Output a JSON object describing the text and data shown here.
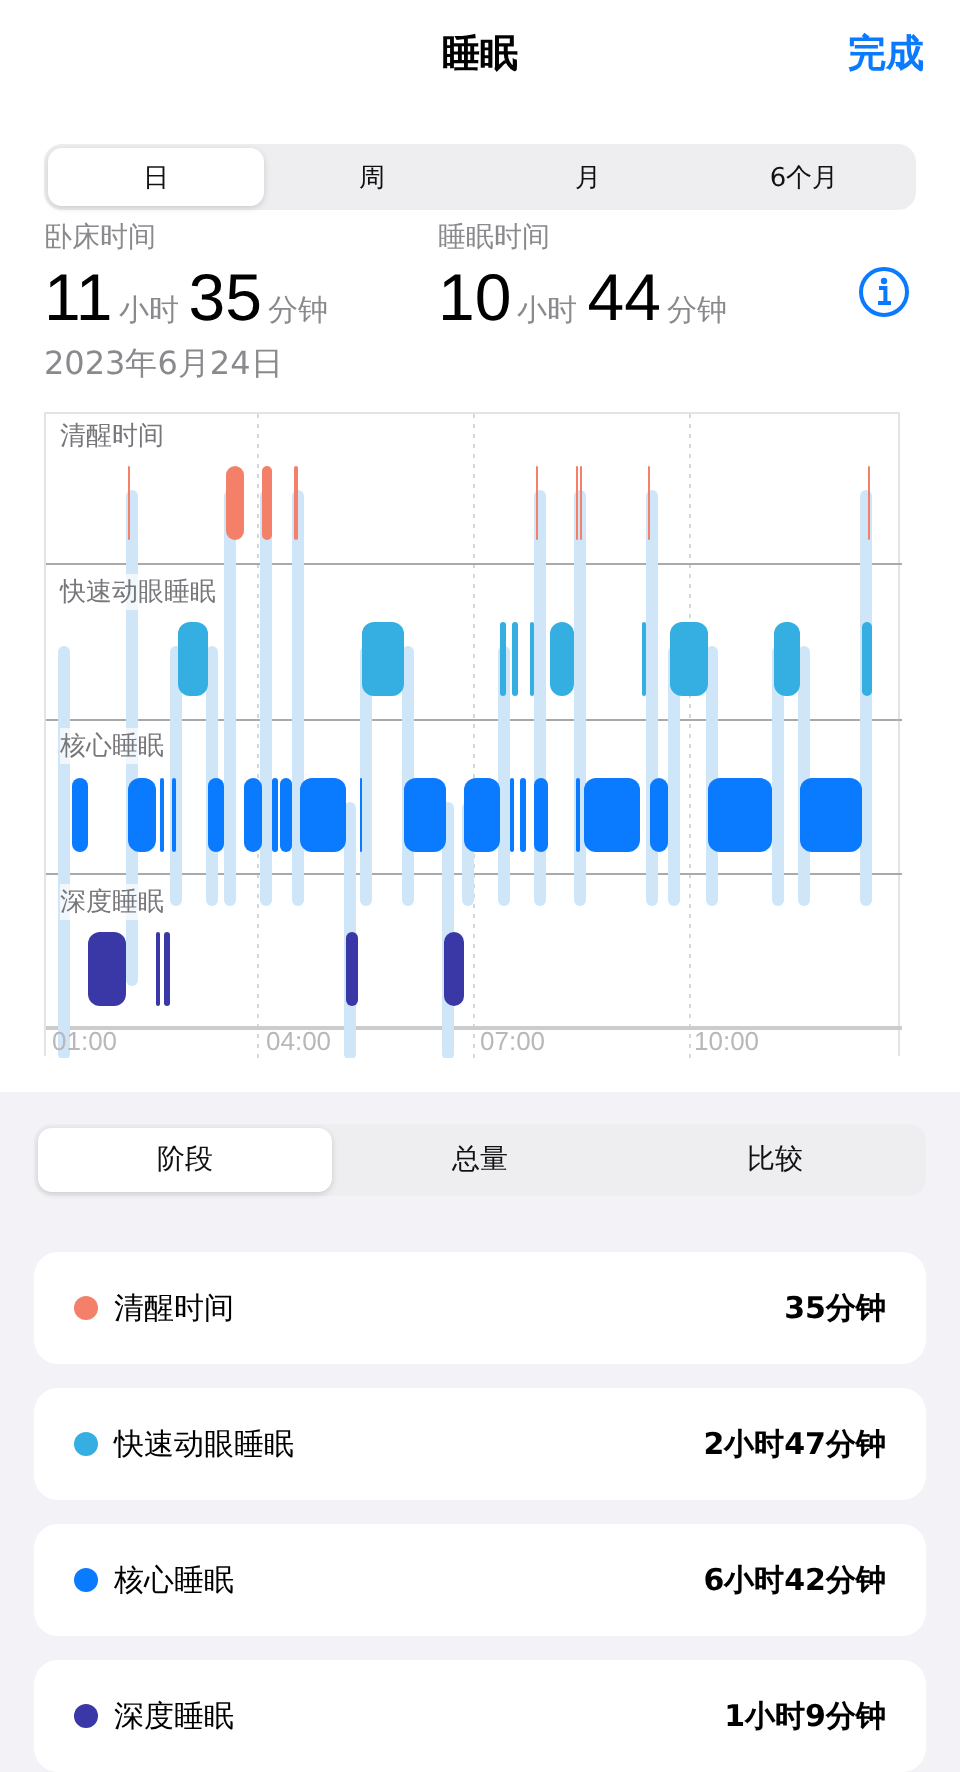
{
  "nav": {
    "title": "睡眠",
    "done": "完成"
  },
  "periods": [
    {
      "label": "日",
      "selected": true
    },
    {
      "label": "周",
      "selected": false
    },
    {
      "label": "月",
      "selected": false
    },
    {
      "label": "6个月",
      "selected": false
    }
  ],
  "stats": [
    {
      "label": "卧床时间",
      "hours": "11",
      "hours_unit": "小时",
      "minutes": "35",
      "minutes_unit": "分钟"
    },
    {
      "label": "睡眠时间",
      "hours": "10",
      "hours_unit": "小时",
      "minutes": "44",
      "minutes_unit": "分钟"
    }
  ],
  "date": "2023年6月24日",
  "chart": {
    "stages": [
      "清醒时间",
      "快速动眼睡眠",
      "核心睡眠",
      "深度睡眠"
    ],
    "x_labels": [
      "01:00",
      "04:00",
      "07:00",
      "10:00"
    ]
  },
  "views": [
    {
      "label": "阶段",
      "selected": true
    },
    {
      "label": "总量",
      "selected": false
    },
    {
      "label": "比较",
      "selected": false
    }
  ],
  "stages": [
    {
      "name": "清醒时间",
      "value": "35分钟",
      "color": "#f5806a"
    },
    {
      "name": "快速动眼睡眠",
      "value": "2小时47分钟",
      "color": "#35aee2"
    },
    {
      "name": "核心睡眠",
      "value": "6小时42分钟",
      "color": "#0a7aff"
    },
    {
      "name": "深度睡眠",
      "value": "1小时9分钟",
      "color": "#3a37a6"
    }
  ]
}
